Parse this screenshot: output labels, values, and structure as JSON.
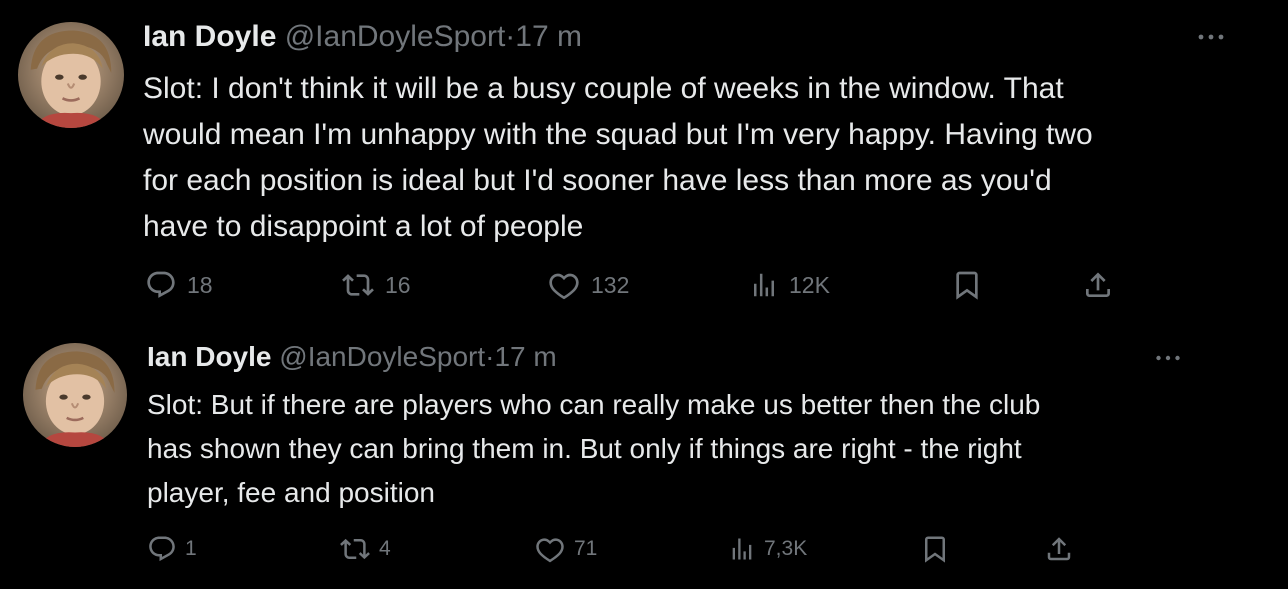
{
  "tweets": [
    {
      "author_name": "Ian Doyle",
      "handle": "@IanDoyleSport",
      "separator": "·",
      "time": "17 m",
      "more_icon": "more-horizontal-icon",
      "lines": [
        "Slot: I don't think it will be a busy couple of weeks in the window. That",
        "would mean I'm unhappy with the squad but I'm very happy. Having two",
        "for each position is ideal but I'd sooner have less than more as you'd",
        "have to disappoint a lot of people"
      ],
      "actions": {
        "replies": "18",
        "reposts": "16",
        "likes": "132",
        "views": "12K"
      }
    },
    {
      "author_name": "Ian Doyle",
      "handle": "@IanDoyleSport",
      "separator": "·",
      "time": "17 m",
      "more_icon": "more-horizontal-icon",
      "lines": [
        "Slot: But if there are players who can really make us better then the club",
        "has shown they can bring them in. But only if things are right - the right",
        "player, fee and position"
      ],
      "actions": {
        "replies": "1",
        "reposts": "4",
        "likes": "71",
        "views": "7,3K"
      }
    }
  ],
  "colors": {
    "background": "#000000",
    "primary_text": "#e7e9ea",
    "secondary_text": "#71767b"
  },
  "icons": [
    "reply-icon",
    "repost-icon",
    "like-icon",
    "views-icon",
    "bookmark-icon",
    "share-icon",
    "more-horizontal-icon"
  ]
}
